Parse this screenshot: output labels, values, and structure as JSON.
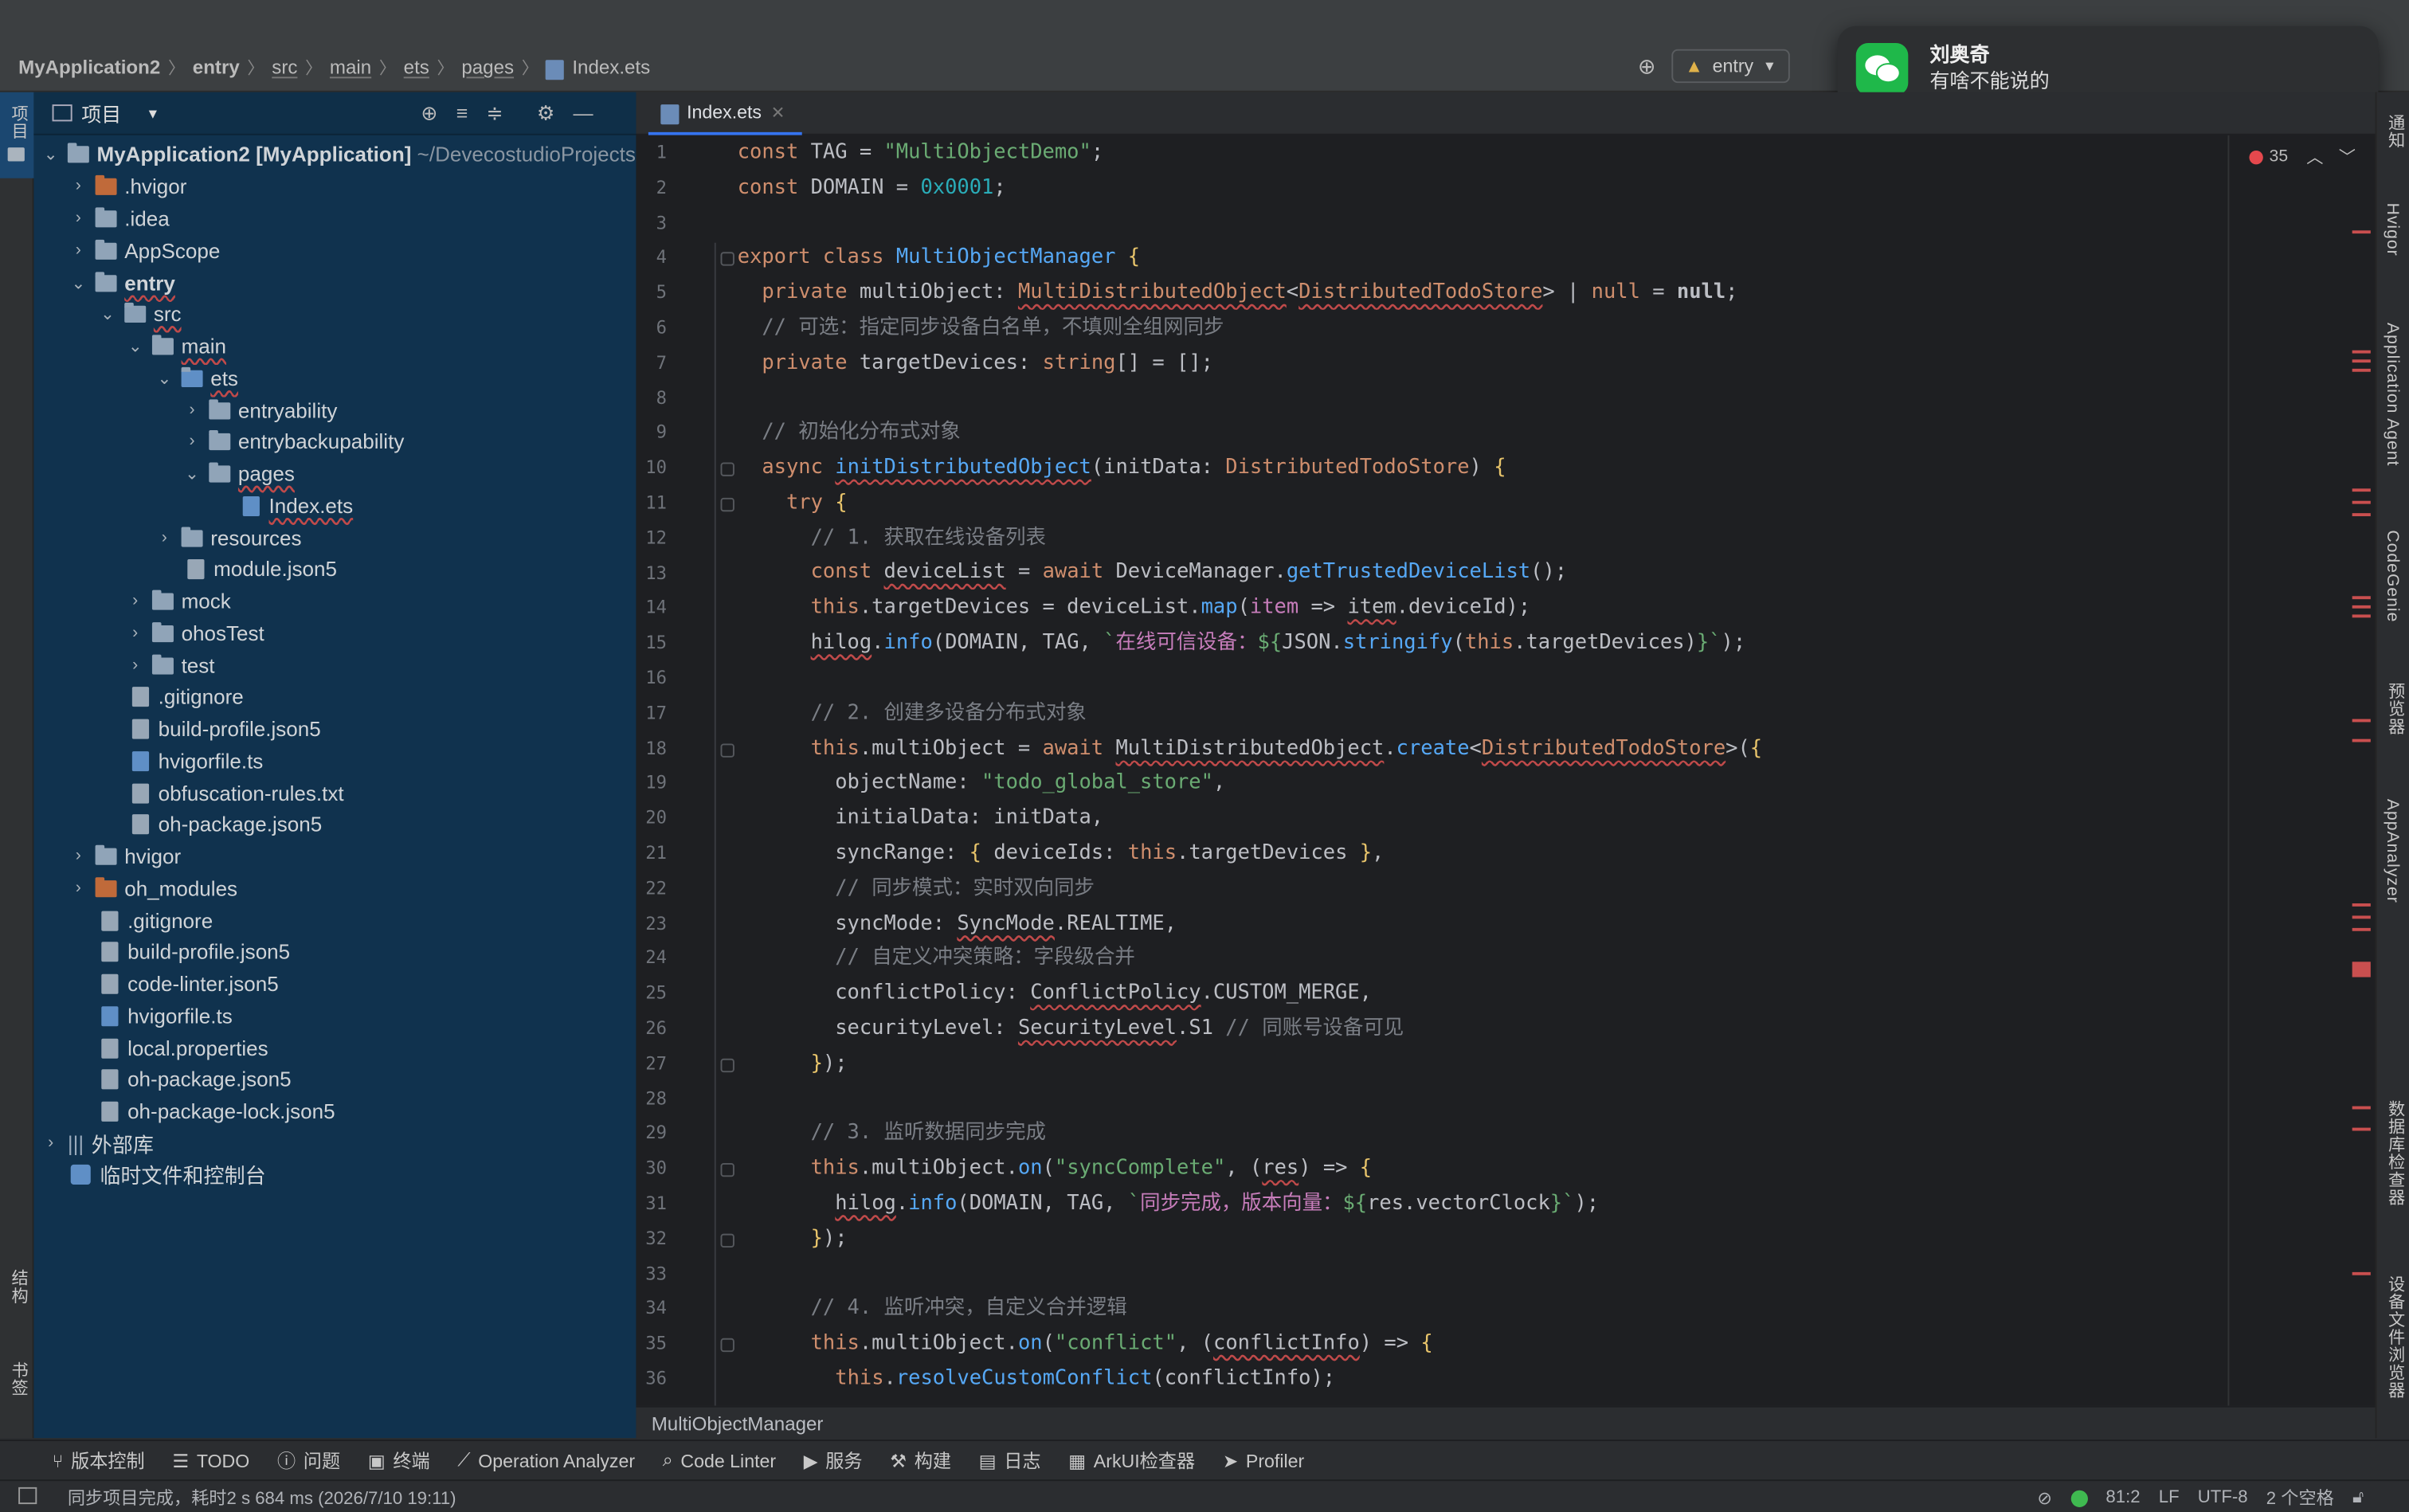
{
  "breadcrumbs": [
    "MyApplication2",
    "entry",
    "src",
    "main",
    "ets",
    "pages",
    "Index.ets"
  ],
  "run_config": "entry",
  "notification": {
    "sender": "刘奥奇",
    "message": "有啥不能说的"
  },
  "left_strip": {
    "project": "项目",
    "structure": "结构",
    "bookmarks": "书签"
  },
  "right_strip": [
    "通知",
    "Hvigor",
    "Application Agent",
    "CodeGenie",
    "预览器",
    "AppAnalyzer",
    "数据库检查器",
    "设备文件浏览器"
  ],
  "project_panel": {
    "title": "项目",
    "root_name": "MyApplication2 [MyApplication]",
    "root_path": "~/DevecostudioProjects",
    "items": [
      ".hvigor",
      ".idea",
      "AppScope",
      "entry",
      "src",
      "main",
      "ets",
      "entryability",
      "entrybackupability",
      "pages",
      "Index.ets",
      "resources",
      "module.json5",
      "mock",
      "ohosTest",
      "test",
      ".gitignore",
      "build-profile.json5",
      "hvigorfile.ts",
      "obfuscation-rules.txt",
      "oh-package.json5",
      "hvigor",
      "oh_modules",
      ".gitignore",
      "build-profile.json5",
      "code-linter.json5",
      "hvigorfile.ts",
      "local.properties",
      "oh-package.json5",
      "oh-package-lock.json5",
      "外部库",
      "临时文件和控制台"
    ]
  },
  "editor": {
    "tab": "Index.ets",
    "error_count": "35",
    "line_numbers": [
      "1",
      "2",
      "3",
      "4",
      "5",
      "6",
      "7",
      "8",
      "9",
      "10",
      "11",
      "12",
      "13",
      "14",
      "15",
      "16",
      "17",
      "18",
      "19",
      "20",
      "21",
      "22",
      "23",
      "24",
      "25",
      "26",
      "27",
      "28",
      "29",
      "30",
      "31",
      "32",
      "33",
      "34",
      "35",
      "36"
    ],
    "scope_breadcrumb": "MultiObjectManager"
  },
  "tool_windows": [
    "版本控制",
    "TODO",
    "问题",
    "终端",
    "Operation Analyzer",
    "Code Linter",
    "服务",
    "构建",
    "日志",
    "ArkUI检查器",
    "Profiler"
  ],
  "status": {
    "message": "同步项目完成，耗时2 s 684 ms (2026/7/10 19:11)",
    "position": "81:2",
    "line_sep": "LF",
    "encoding": "UTF-8",
    "indent": "2 个空格"
  }
}
